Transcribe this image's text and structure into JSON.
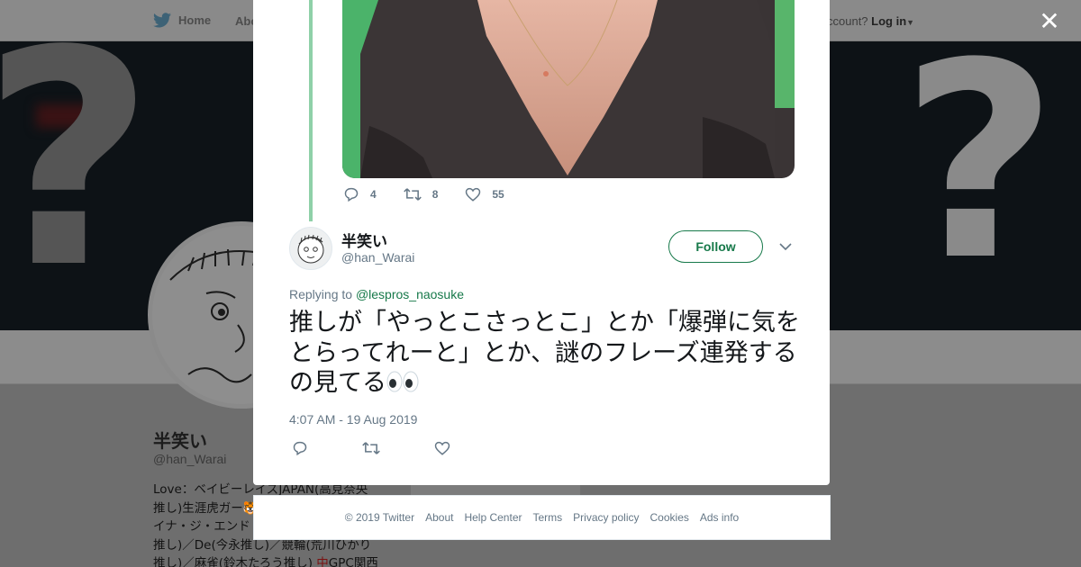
{
  "topbar": {
    "home_label": "Home",
    "about_label": "Abo",
    "account_prompt": "ccount?",
    "login_label": "Log in"
  },
  "profile": {
    "name": "半笑い",
    "handle": "@han_Warai",
    "bio_lines": [
      "Love：ベイビーレイズJAPAN(高見奈央",
      "推し)生涯虎ガー🐯",
      "イナ・ジ・エンド",
      "推し)／De(今永推し)／競輪(荒川ひかり",
      "推し)／麻雀(鈴木たろう推し)",
      "GPC関西"
    ],
    "mahjong_tile": "中",
    "card_text": "Ads info"
  },
  "previous_tweet": {
    "reply_count": "4",
    "retweet_count": "8",
    "like_count": "55"
  },
  "tweet": {
    "author_name": "半笑い",
    "author_handle": "@han_Warai",
    "follow_label": "Follow",
    "replying_prefix": "Replying to",
    "replying_to": "@lespros_naosuke",
    "text": "推しが「やっとこさっとこ」とか「爆弾に気をとらってれーと」とか、謎のフレーズ連発するの見てる",
    "timestamp": "4:07 AM - 19 Aug 2019"
  },
  "footer": {
    "items": [
      "© 2019 Twitter",
      "About",
      "Help Center",
      "Terms",
      "Privacy policy",
      "Cookies",
      "Ads info"
    ]
  },
  "colors": {
    "accent": "#17794a",
    "thread_line": "#8fd0a8",
    "muted": "#657786",
    "overlay": "#6e6e6e"
  },
  "icons": [
    "twitter-bird-icon",
    "close-icon",
    "reply-icon",
    "retweet-icon",
    "heart-icon",
    "chevron-down-icon",
    "eyes-emoji-icon"
  ]
}
